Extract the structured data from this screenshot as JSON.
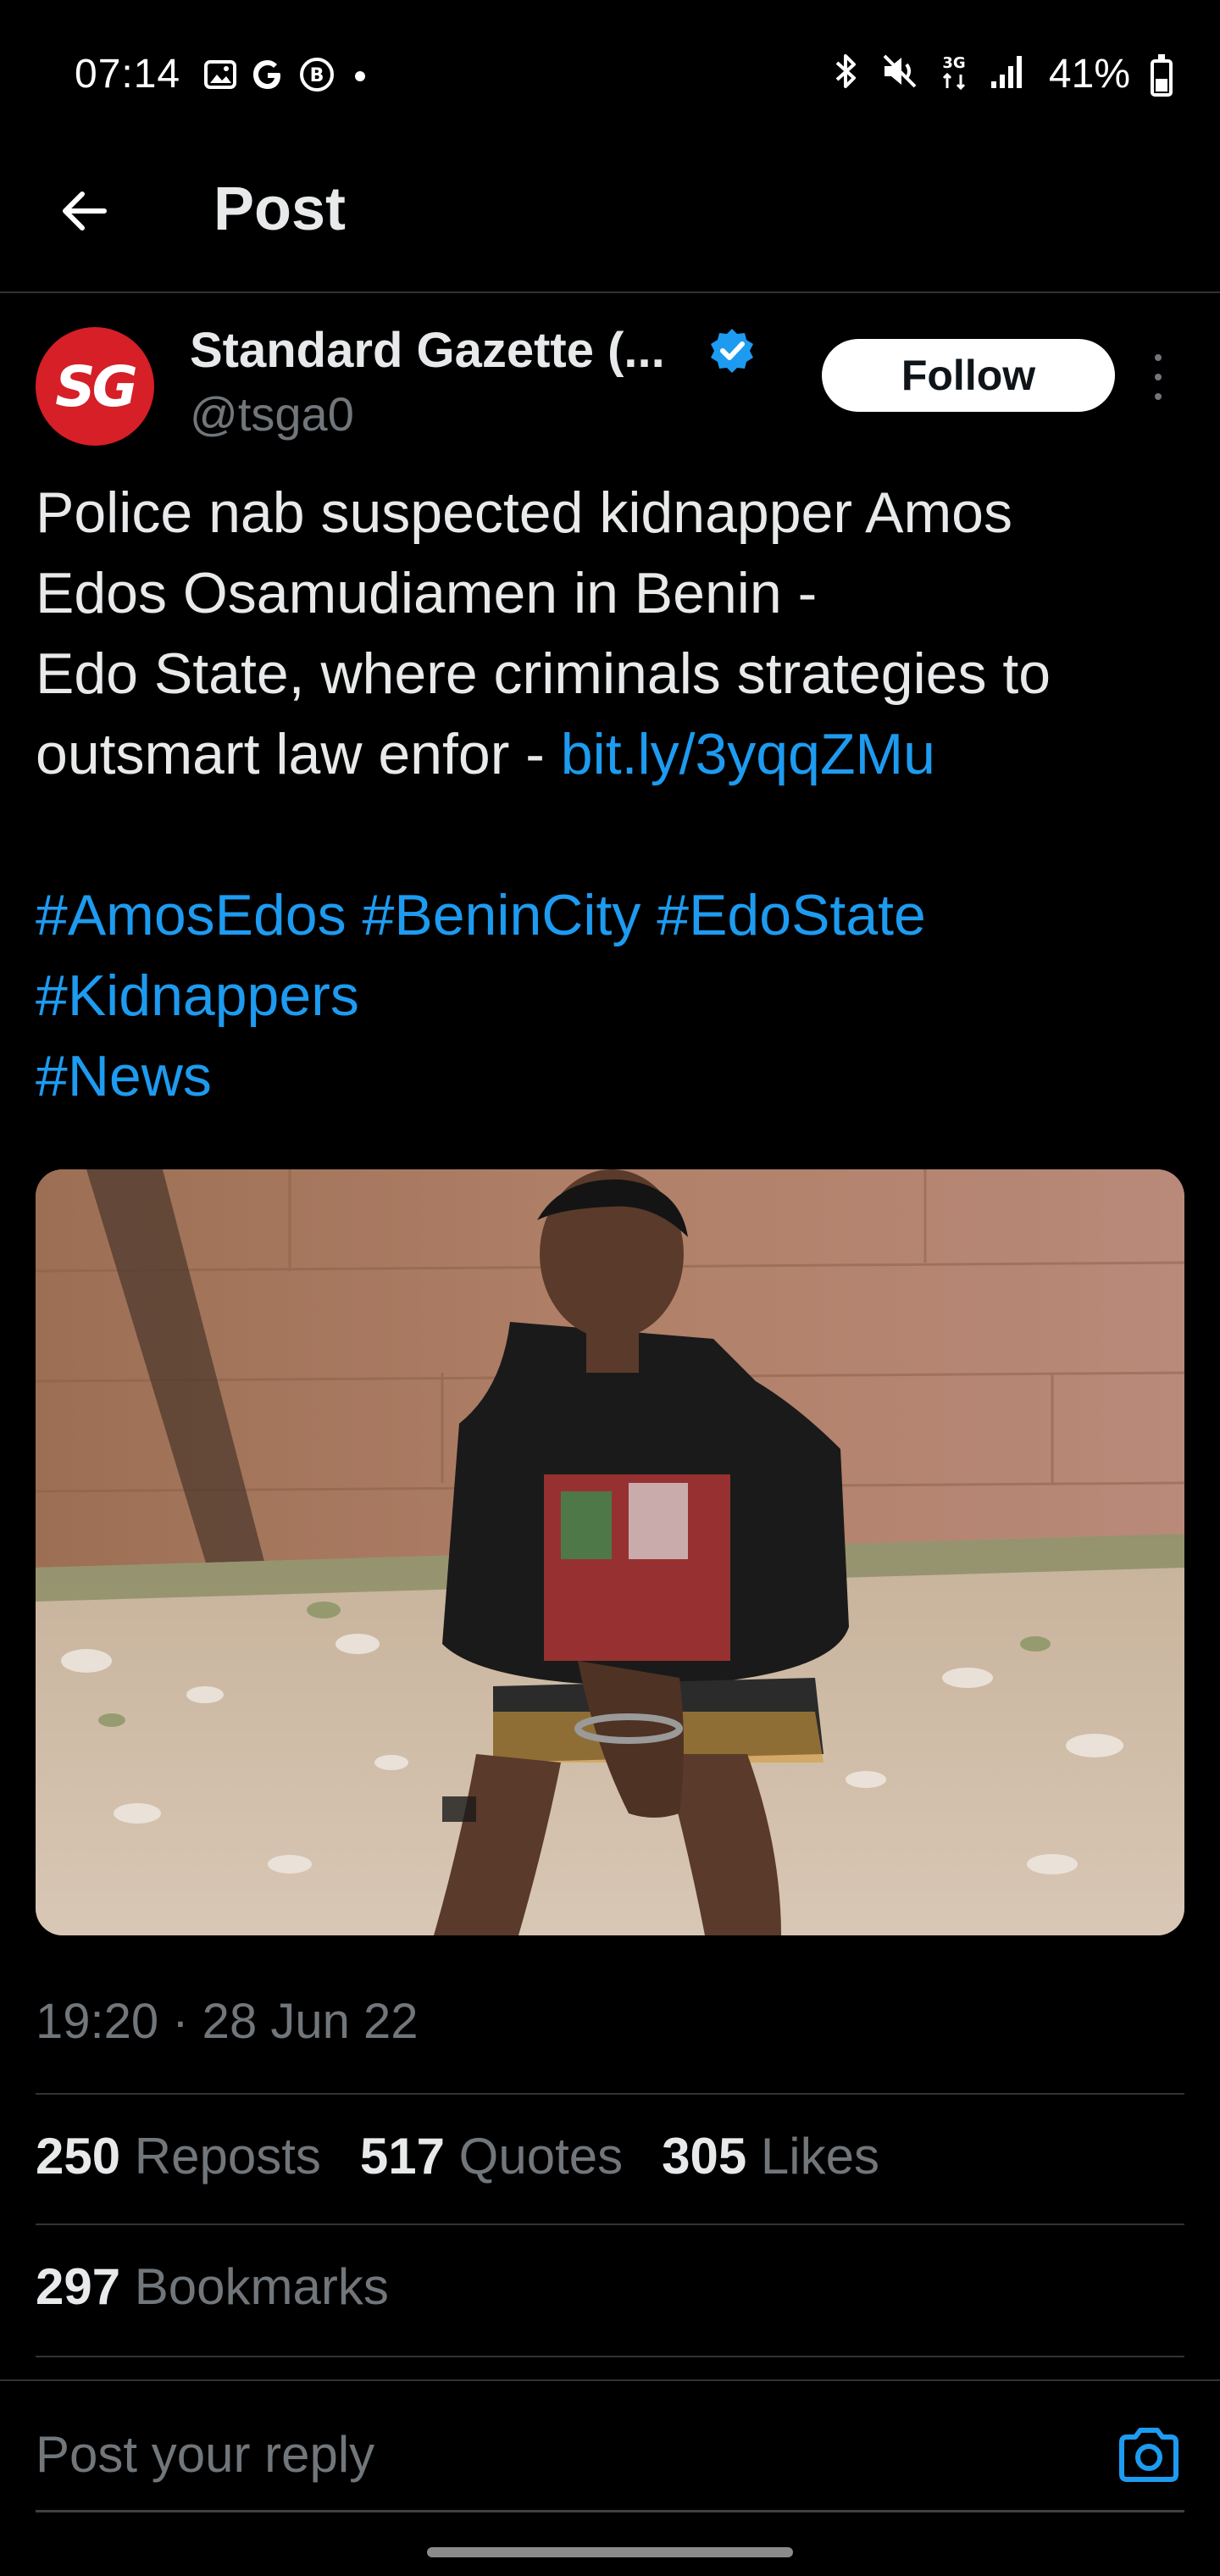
{
  "status_bar": {
    "time": "07:14",
    "left_icons": [
      "gallery-icon",
      "google-icon",
      "b-icon",
      "dot-icon"
    ],
    "right_icons": [
      "bluetooth-icon",
      "mute-icon",
      "3g-icon",
      "signal-icon"
    ],
    "network_label": "3G",
    "battery": "41%",
    "battery_level": 0.41
  },
  "header": {
    "title": "Post"
  },
  "author": {
    "avatar_text": "SG",
    "name": "Standard Gazette (...",
    "handle": "@tsga0",
    "verified": true,
    "follow_label": "Follow"
  },
  "tweet": {
    "line1": "Police nab suspected kidnapper Amos",
    "line2": "Edos Osamudiamen in Benin -",
    "line3": "Edo State, where criminals strategies to",
    "line4_text": "outsmart law enfor - ",
    "link": "bit.ly/3yqqZMu",
    "hashtags_line1": "#AmosEdos #BeninCity #EdoState",
    "hashtags_line2": "#Kidnappers",
    "hashtags_line3": "#News"
  },
  "post_meta": {
    "timestamp": "19:20 · 28 Jun 22",
    "reposts_count": "250",
    "reposts_label": "Reposts",
    "quotes_count": "517",
    "quotes_label": "Quotes",
    "likes_count": "305",
    "likes_label": "Likes",
    "bookmarks_count": "297",
    "bookmarks_label": "Bookmarks"
  },
  "reply": {
    "placeholder": "Post your reply"
  },
  "colors": {
    "background": "#000000",
    "text": "#e7e9ea",
    "muted": "#71767b",
    "link": "#1d9bf0",
    "avatar_bg": "#d61f26"
  }
}
